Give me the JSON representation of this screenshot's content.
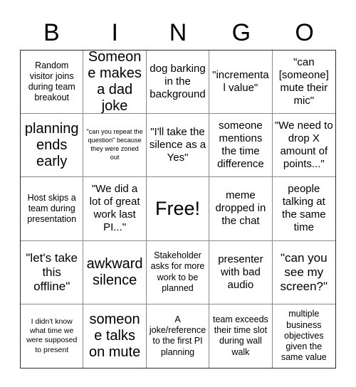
{
  "card": {
    "title": "BINGO",
    "header_letters": [
      "B",
      "I",
      "N",
      "G",
      "O"
    ],
    "columns": 5,
    "rows": 5,
    "free_space_index": 12,
    "colors": {
      "text": "#000000",
      "cell_background": "#ffffff",
      "inner_border": "#8a8a8a",
      "outer_border": "#2b2b2b",
      "page_background": "#ffffff"
    }
  },
  "cells": [
    {
      "text": "Random visitor joins during team breakout",
      "size": "sm",
      "free": false
    },
    {
      "text": "Someone makes a dad joke",
      "size": "xl",
      "free": false
    },
    {
      "text": "dog barking in the background",
      "size": "md",
      "free": false
    },
    {
      "text": "\"incremental value\"",
      "size": "md",
      "free": false
    },
    {
      "text": "\"can [someone] mute their mic\"",
      "size": "md",
      "free": false
    },
    {
      "text": "planning ends early",
      "size": "xl",
      "free": false
    },
    {
      "text": "\"can you repeat the question\" because they were zoned out",
      "size": "xxs",
      "free": false
    },
    {
      "text": "\"I'll take the silence as a Yes\"",
      "size": "md",
      "free": false
    },
    {
      "text": "someone mentions the time difference",
      "size": "md",
      "free": false
    },
    {
      "text": "\"We need to drop X amount of points...\"",
      "size": "md",
      "free": false
    },
    {
      "text": "Host skips a team during presentation",
      "size": "sm",
      "free": false
    },
    {
      "text": "\"We did a lot of great work last PI...\"",
      "size": "md",
      "free": false
    },
    {
      "text": "Free!",
      "size": "xxl",
      "free": true
    },
    {
      "text": "meme dropped in the chat",
      "size": "md",
      "free": false
    },
    {
      "text": "people talking at the same time",
      "size": "md",
      "free": false
    },
    {
      "text": "\"let's take this offline\"",
      "size": "lg",
      "free": false
    },
    {
      "text": "awkward silence",
      "size": "xl",
      "free": false
    },
    {
      "text": "Stakeholder asks for more work to be planned",
      "size": "sm",
      "free": false
    },
    {
      "text": "presenter with bad audio",
      "size": "md",
      "free": false
    },
    {
      "text": "\"can you see my screen?\"",
      "size": "lg",
      "free": false
    },
    {
      "text": "I didn't know what time we were supposed to present",
      "size": "xs",
      "free": false
    },
    {
      "text": "someone talks on mute",
      "size": "xl",
      "free": false
    },
    {
      "text": "A joke/reference to the first PI planning",
      "size": "sm",
      "free": false
    },
    {
      "text": "team exceeds their time slot during wall walk",
      "size": "sm",
      "free": false
    },
    {
      "text": "multiple business objectives given the same value",
      "size": "sm",
      "free": false
    }
  ]
}
